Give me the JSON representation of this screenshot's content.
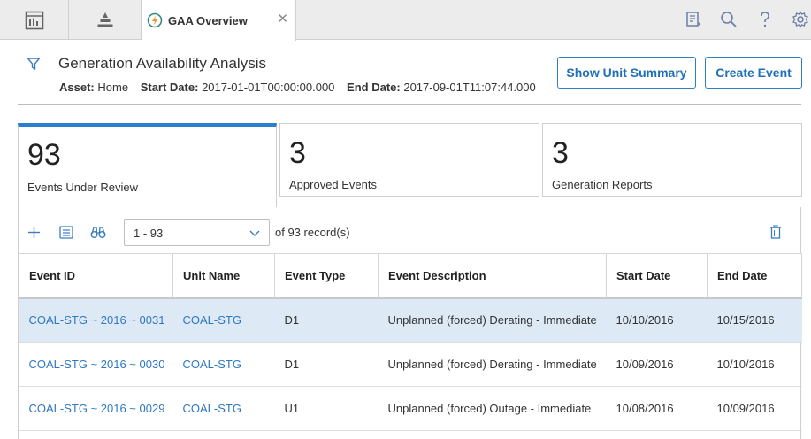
{
  "topbar": {
    "tabs": [
      {
        "icon": "dashboard-icon"
      },
      {
        "icon": "hierarchy-icon"
      }
    ],
    "active_tab": {
      "title": "GAA Overview",
      "icon": "gaa-icon",
      "close": "✕"
    },
    "right_icons": [
      "notes-icon",
      "search-icon",
      "help-icon",
      "gear-icon"
    ]
  },
  "header": {
    "title": "Generation Availability Analysis",
    "asset_label": "Asset:",
    "asset_value": "Home",
    "start_label": "Start Date:",
    "start_value": "2017-01-01T00:00:00.000",
    "end_label": "End Date:",
    "end_value": "2017-09-01T11:07:44.000",
    "show_unit_summary": "Show Unit Summary",
    "create_event": "Create Event"
  },
  "cards": [
    {
      "count": "93",
      "label": "Events Under Review",
      "active": true
    },
    {
      "count": "3",
      "label": "Approved Events",
      "active": false
    },
    {
      "count": "3",
      "label": "Generation Reports",
      "active": false
    }
  ],
  "grid": {
    "pager_value": "1 - 93",
    "records_text": "of 93 record(s)",
    "columns": [
      "Event ID",
      "Unit Name",
      "Event Type",
      "Event Description",
      "Start Date",
      "End Date"
    ],
    "rows": [
      [
        "COAL-STG ~ 2016 ~ 0031",
        "COAL-STG",
        "D1",
        "Unplanned (forced) Derating - Immediate",
        "10/10/2016",
        "10/15/2016"
      ],
      [
        "COAL-STG ~ 2016 ~ 0030",
        "COAL-STG",
        "D1",
        "Unplanned (forced) Derating - Immediate",
        "10/09/2016",
        "10/10/2016"
      ],
      [
        "COAL-STG ~ 2016 ~ 0029",
        "COAL-STG",
        "U1",
        "Unplanned (forced) Outage - Immediate",
        "10/08/2016",
        "10/09/2016"
      ]
    ]
  },
  "colors": {
    "accent": "#2b7fd0",
    "link": "#2e78c2",
    "selected_row": "#dde9f5"
  }
}
